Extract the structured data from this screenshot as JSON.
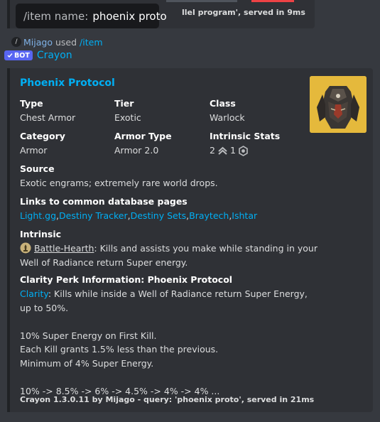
{
  "previous": {
    "footer": "llel program', served in 9ms"
  },
  "tooltip": {
    "label": "/item name:",
    "value": "phoenix proto"
  },
  "command": {
    "icon": "slash-icon",
    "user": "Mijago",
    "used": "used",
    "name": "/item"
  },
  "author": {
    "badge": "BOT",
    "name": "Crayon"
  },
  "embed": {
    "title": "Phoenix Protocol",
    "thumbnail_icon": "chest-armor-icon",
    "fields": {
      "type_label": "Type",
      "type_value": "Chest Armor",
      "tier_label": "Tier",
      "tier_value": "Exotic",
      "class_label": "Class",
      "class_value": "Warlock",
      "category_label": "Category",
      "category_value": "Armor",
      "armor_type_label": "Armor Type",
      "armor_type_value": "Armor 2.0",
      "intrinsic_stats_label": "Intrinsic Stats",
      "stat1_value": "2",
      "stat1_icon": "mobility-chevron-icon",
      "stat2_value": "1",
      "stat2_icon": "recovery-hex-icon"
    },
    "source": {
      "label": "Source",
      "text": "Exotic engrams; extremely rare world drops."
    },
    "links": {
      "label": "Links to common database pages",
      "items": [
        "Light.gg",
        "Destiny Tracker",
        "Destiny Sets",
        "Braytech",
        "Ishtar"
      ],
      "separator": ", "
    },
    "intrinsic": {
      "label": "Intrinsic",
      "icon": "battle-hearth-icon",
      "perk_name": "Battle-Hearth",
      "line1": ": Kills and assists you make while standing in your",
      "line2": "Well of Radiance return Super energy."
    },
    "clarity": {
      "label": "Clarity Perk Information: Phoenix Protocol",
      "link": "Clarity",
      "line1": ": Kills while inside a Well of Radiance return Super Energy,",
      "line2": "up to 50%.",
      "line3": "10% Super Energy on First Kill.",
      "line4": "Each Kill grants 1.5% less than the previous.",
      "line5": "Minimum of 4% Super Energy.",
      "line6": "10% -> 8.5% -> 6% -> 4.5% -> 4% -> 4% ..."
    },
    "footer": "Crayon 1.3.0.11 by Mijago - query: 'phoenix proto', served in 21ms"
  },
  "colors": {
    "background": "#36393f",
    "embed": "#2f3136",
    "link": "#00aff4",
    "bot_badge": "#5865f2",
    "thumb_bg": "#e5b93c"
  }
}
